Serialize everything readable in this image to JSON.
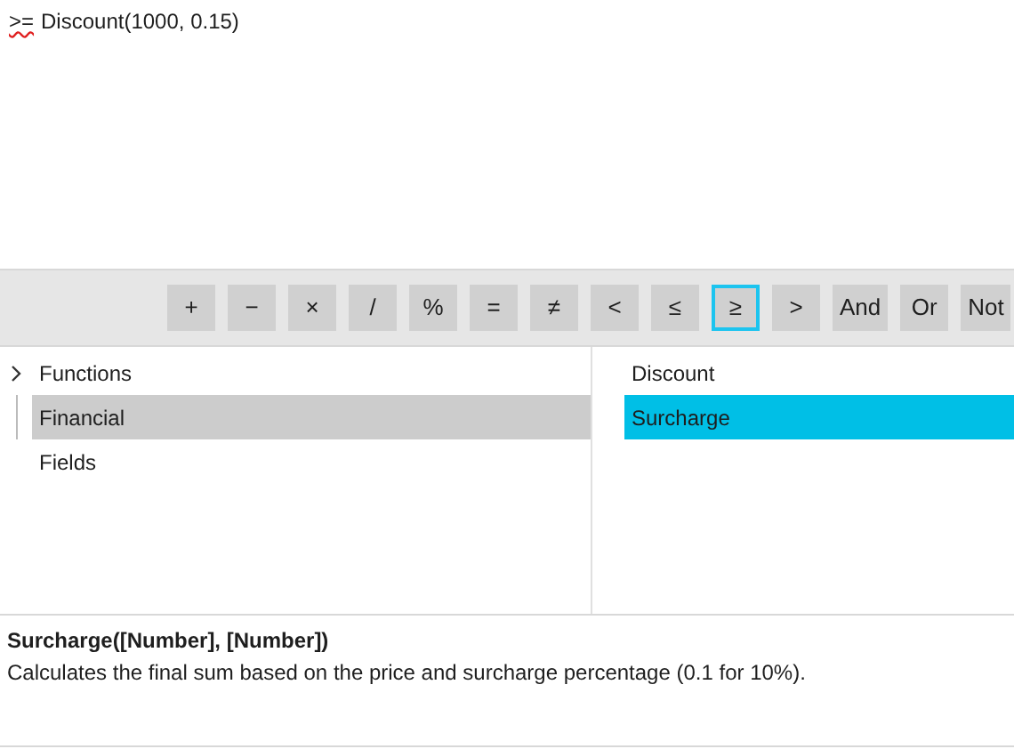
{
  "editor": {
    "tokens": [
      {
        "text": ">=",
        "misspelled": true
      },
      {
        "text": "Discount(1000, 0.15)",
        "misspelled": false
      }
    ]
  },
  "operators": [
    {
      "label": "+",
      "selected": false
    },
    {
      "label": "−",
      "selected": false
    },
    {
      "label": "×",
      "selected": false
    },
    {
      "label": "/",
      "selected": false
    },
    {
      "label": "%",
      "selected": false
    },
    {
      "label": "=",
      "selected": false
    },
    {
      "label": "≠",
      "selected": false
    },
    {
      "label": "<",
      "selected": false
    },
    {
      "label": "≤",
      "selected": false
    },
    {
      "label": "≥",
      "selected": true
    },
    {
      "label": ">",
      "selected": false
    },
    {
      "label": "And",
      "selected": false
    },
    {
      "label": "Or",
      "selected": false
    },
    {
      "label": "Not",
      "selected": false
    }
  ],
  "categories": [
    {
      "label": "Functions",
      "expanded": false,
      "selected": false,
      "children": [
        {
          "label": "Financial",
          "selected": true
        }
      ]
    },
    {
      "label": "Fields",
      "selected": false
    }
  ],
  "members": [
    {
      "label": "Discount",
      "selected": false
    },
    {
      "label": "Surcharge",
      "selected": true
    }
  ],
  "description": {
    "signature": "Surcharge([Number], [Number])",
    "text": "Calculates the final sum based on the price and surcharge percentage (0.1 for 10%)."
  }
}
